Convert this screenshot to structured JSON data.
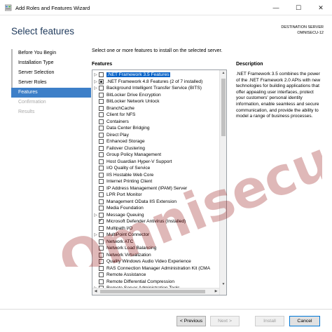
{
  "window": {
    "title": "Add Roles and Features Wizard",
    "controls": {
      "minimize": "—",
      "maximize": "☐",
      "close": "✕"
    }
  },
  "header": {
    "page_title": "Select features",
    "destination_label": "DESTINATION SERVER",
    "destination_server": "OMNISECU-12"
  },
  "nav": {
    "items": [
      {
        "label": "Before You Begin",
        "state": "normal"
      },
      {
        "label": "Installation Type",
        "state": "normal"
      },
      {
        "label": "Server Selection",
        "state": "normal"
      },
      {
        "label": "Server Roles",
        "state": "normal"
      },
      {
        "label": "Features",
        "state": "active"
      },
      {
        "label": "Confirmation",
        "state": "disabled"
      },
      {
        "label": "Results",
        "state": "disabled"
      }
    ]
  },
  "main": {
    "instruction": "Select one or more features to install on the selected server.",
    "features_heading": "Features",
    "features": [
      {
        "label": ".NET Framework 3.5 Features",
        "expandable": true,
        "state": "unchecked",
        "selected": true
      },
      {
        "label": ".NET Framework 4.8 Features (2 of 7 installed)",
        "expandable": true,
        "state": "partial"
      },
      {
        "label": "Background Intelligent Transfer Service (BITS)",
        "expandable": true,
        "state": "unchecked"
      },
      {
        "label": "BitLocker Drive Encryption",
        "expandable": false,
        "state": "unchecked"
      },
      {
        "label": "BitLocker Network Unlock",
        "expandable": false,
        "state": "unchecked"
      },
      {
        "label": "BranchCache",
        "expandable": false,
        "state": "unchecked"
      },
      {
        "label": "Client for NFS",
        "expandable": false,
        "state": "unchecked"
      },
      {
        "label": "Containers",
        "expandable": false,
        "state": "unchecked"
      },
      {
        "label": "Data Center Bridging",
        "expandable": false,
        "state": "unchecked"
      },
      {
        "label": "Direct Play",
        "expandable": false,
        "state": "unchecked"
      },
      {
        "label": "Enhanced Storage",
        "expandable": false,
        "state": "unchecked"
      },
      {
        "label": "Failover Clustering",
        "expandable": false,
        "state": "unchecked"
      },
      {
        "label": "Group Policy Management",
        "expandable": false,
        "state": "unchecked"
      },
      {
        "label": "Host Guardian Hyper-V Support",
        "expandable": false,
        "state": "unchecked"
      },
      {
        "label": "I/O Quality of Service",
        "expandable": false,
        "state": "unchecked"
      },
      {
        "label": "IIS Hostable Web Core",
        "expandable": false,
        "state": "unchecked"
      },
      {
        "label": "Internet Printing Client",
        "expandable": false,
        "state": "unchecked"
      },
      {
        "label": "IP Address Management (IPAM) Server",
        "expandable": false,
        "state": "unchecked"
      },
      {
        "label": "LPR Port Monitor",
        "expandable": false,
        "state": "unchecked"
      },
      {
        "label": "Management OData IIS Extension",
        "expandable": false,
        "state": "unchecked"
      },
      {
        "label": "Media Foundation",
        "expandable": false,
        "state": "unchecked"
      },
      {
        "label": "Message Queuing",
        "expandable": true,
        "state": "unchecked"
      },
      {
        "label": "Microsoft Defender Antivirus (Installed)",
        "expandable": false,
        "state": "checked"
      },
      {
        "label": "Multipath I/O",
        "expandable": false,
        "state": "unchecked"
      },
      {
        "label": "MultiPoint Connector",
        "expandable": true,
        "state": "unchecked"
      },
      {
        "label": "Network ATC",
        "expandable": false,
        "state": "unchecked"
      },
      {
        "label": "Network Load Balancing",
        "expandable": false,
        "state": "unchecked"
      },
      {
        "label": "Network Virtualization",
        "expandable": false,
        "state": "unchecked"
      },
      {
        "label": "Quality Windows Audio Video Experience",
        "expandable": false,
        "state": "unchecked"
      },
      {
        "label": "RAS Connection Manager Administration Kit (CMA",
        "expandable": false,
        "state": "unchecked"
      },
      {
        "label": "Remote Assistance",
        "expandable": false,
        "state": "unchecked"
      },
      {
        "label": "Remote Differential Compression",
        "expandable": false,
        "state": "unchecked"
      },
      {
        "label": "Remote Server Administration Tools",
        "expandable": true,
        "state": "unchecked"
      }
    ],
    "description_heading": "Description",
    "description": ".NET Framework 3.5 combines the power of the .NET Framework 2.0 APIs with new technologies for building applications that offer appealing user interfaces, protect your customers' personal identity information, enable seamless and secure communication, and provide the ability to model a range of business processes."
  },
  "buttons": {
    "previous": "< Previous",
    "next": "Next >",
    "install": "Install",
    "cancel": "Cancel"
  },
  "watermark": {
    "text": "Omnisecu.com"
  },
  "colors": {
    "accent": "#3d7fc8",
    "selection": "#0a64c8",
    "heading": "#1e395b",
    "watermark": "#8b0000"
  }
}
